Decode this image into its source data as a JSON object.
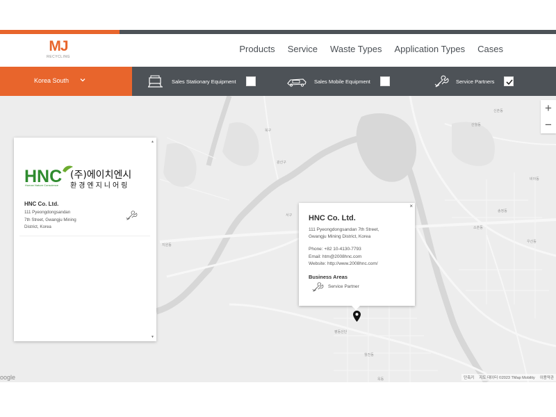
{
  "brand": {
    "mark": "MJ",
    "sub": "RECYCLING",
    "accent": "#e8652c",
    "dark": "#4d5257"
  },
  "nav": [
    "Products",
    "Service",
    "Waste Types",
    "Application Types",
    "Cases"
  ],
  "filters": {
    "region": "Korea South",
    "stationary": {
      "label": "Sales Stationary Equipment",
      "checked": false,
      "icon": "stationary-equipment-icon"
    },
    "mobile": {
      "label": "Sales Mobile Equipment",
      "checked": false,
      "icon": "mobile-equipment-icon"
    },
    "partners": {
      "label": "Service Partners",
      "checked": true,
      "icon": "service-partner-icon"
    }
  },
  "map": {
    "zoom_in": "+",
    "zoom_out": "−",
    "google": "oogle",
    "attribution": [
      "단축키",
      "지도 데이터 ©2023 TMap Mobility",
      "이용약관"
    ]
  },
  "card": {
    "logo_text": "(주)에이치엔시",
    "logo_sub": "환경엔지니어링",
    "logo_hnc": "HNC",
    "logo_tagline": "Human Nature Conscience",
    "company_name": "HNC Co. Ltd.",
    "address_lines": [
      "111 Pyeongdongsandan",
      "7th Street, Gwangju Mining",
      "District, Korea"
    ]
  },
  "popup": {
    "close": "×",
    "title": "HNC Co. Ltd.",
    "address_lines": [
      "111 Pyeongdongsandan 7th Street,",
      "Gwangju Mining District, Korea"
    ],
    "phone": "Phone: +82 10-4130-7793",
    "email": "Email: htm@2008hnc.com",
    "website": "Website: http://www.2008hnc.com/",
    "areas_title": "Business Areas",
    "area": "Service Partner"
  }
}
